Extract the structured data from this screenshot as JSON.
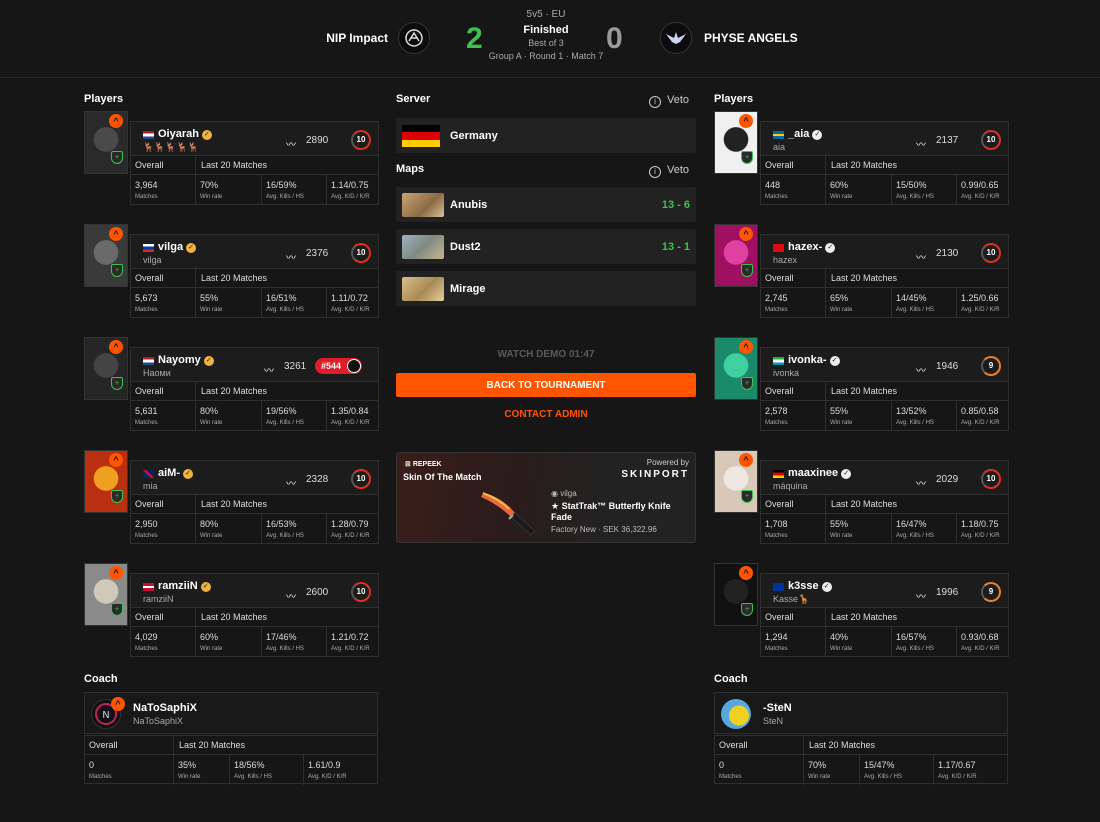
{
  "header": {
    "format": "5v5 · EU",
    "status": "Finished",
    "best_of": "Best of 3",
    "group": "Group A · Round 1 · Match 7",
    "team1": {
      "name": "NIP Impact",
      "score": "2"
    },
    "team2": {
      "name": "PHYSE ANGELS",
      "score": "0"
    }
  },
  "labels": {
    "players": "Players",
    "coach": "Coach",
    "server": "Server",
    "maps": "Maps",
    "veto": "Veto",
    "overall": "Overall",
    "last20": "Last 20 Matches",
    "matches": "Matches",
    "win_rate": "Win rate",
    "avg_kills_hs": "Avg. Kills / HS",
    "avg_kd_kr": "Avg. K/D / K/R"
  },
  "server": {
    "name": "Germany"
  },
  "maps": [
    {
      "name": "Anubis",
      "score": "13 - 6"
    },
    {
      "name": "Dust2",
      "score": "13 - 1"
    },
    {
      "name": "Mirage",
      "score": ""
    }
  ],
  "actions": {
    "watch_demo": "WATCH DEMO  01:47",
    "back": "BACK TO TOURNAMENT",
    "contact": "CONTACT ADMIN"
  },
  "skin": {
    "brand": "REPEEK",
    "title": "Skin Of The Match",
    "powered": "Powered by",
    "provider": "SKINPORT",
    "owner": "vilga",
    "item": "★ StatTrak™ Butterfly Knife Fade",
    "condition": "Factory New · SEK 36,322.96"
  },
  "team1_players": [
    {
      "name": "Oiyarah",
      "sub": "🦌🦌🦌🦌🦌",
      "elo": "2890",
      "level": "10",
      "flag": "nl",
      "matches": "3,964",
      "win_rate": "70%",
      "kills_hs": "16/59%",
      "kd_kr": "1.14/0.75"
    },
    {
      "name": "vilga",
      "sub": "vilga",
      "elo": "2376",
      "level": "10",
      "flag": "ru",
      "matches": "5,673",
      "win_rate": "55%",
      "kills_hs": "16/51%",
      "kd_kr": "1.11/0.72"
    },
    {
      "name": "Nayomy",
      "sub": "Наоми",
      "elo": "3261",
      "rank": "#544",
      "flag": "nl",
      "matches": "5,631",
      "win_rate": "80%",
      "kills_hs": "19/56%",
      "kd_kr": "1.35/0.84"
    },
    {
      "name": "aiM-",
      "sub": "mia",
      "elo": "2328",
      "level": "10",
      "flag": "gb",
      "matches": "2,950",
      "win_rate": "80%",
      "kills_hs": "16/53%",
      "kd_kr": "1.28/0.79"
    },
    {
      "name": "ramziiN",
      "sub": "ramziiN",
      "elo": "2600",
      "level": "10",
      "flag": "dk",
      "matches": "4,029",
      "win_rate": "60%",
      "kills_hs": "17/46%",
      "kd_kr": "1.21/0.72"
    }
  ],
  "team2_players": [
    {
      "name": "_aia",
      "sub": "aia",
      "elo": "2137",
      "level": "10",
      "flag": "se",
      "matches": "448",
      "win_rate": "60%",
      "kills_hs": "15/50%",
      "kd_kr": "0.99/0.65"
    },
    {
      "name": "hazex-",
      "sub": "hazex",
      "elo": "2130",
      "level": "10",
      "flag": "tr",
      "matches": "2,745",
      "win_rate": "65%",
      "kills_hs": "14/45%",
      "kd_kr": "1.25/0.66"
    },
    {
      "name": "ivonka-",
      "sub": "ivonka",
      "elo": "1946",
      "level": "9",
      "flag": "uz",
      "matches": "2,578",
      "win_rate": "55%",
      "kills_hs": "13/52%",
      "kd_kr": "0.85/0.58"
    },
    {
      "name": "maaxinee",
      "sub": "máquina",
      "elo": "2029",
      "level": "10",
      "flag": "de",
      "matches": "1,708",
      "win_rate": "55%",
      "kills_hs": "16/47%",
      "kd_kr": "1.18/0.75"
    },
    {
      "name": "k3sse",
      "sub": "Kasse🦒",
      "elo": "1996",
      "level": "9",
      "flag": "eu",
      "matches": "1,294",
      "win_rate": "40%",
      "kills_hs": "16/57%",
      "kd_kr": "0.93/0.68"
    }
  ],
  "coach1": {
    "name": "NaToSaphiX",
    "sub": "NaToSaphiX",
    "matches": "0",
    "win_rate": "35%",
    "kills_hs": "18/56%",
    "kd_kr": "1.61/0.9"
  },
  "coach2": {
    "name": "-SteN",
    "sub": "SteN",
    "matches": "0",
    "win_rate": "70%",
    "kills_hs": "15/47%",
    "kd_kr": "1.17/0.67"
  },
  "colors": {
    "accent": "#ff5500",
    "win": "#3cc24f",
    "level_red": "#e03020",
    "background": "#161616"
  }
}
